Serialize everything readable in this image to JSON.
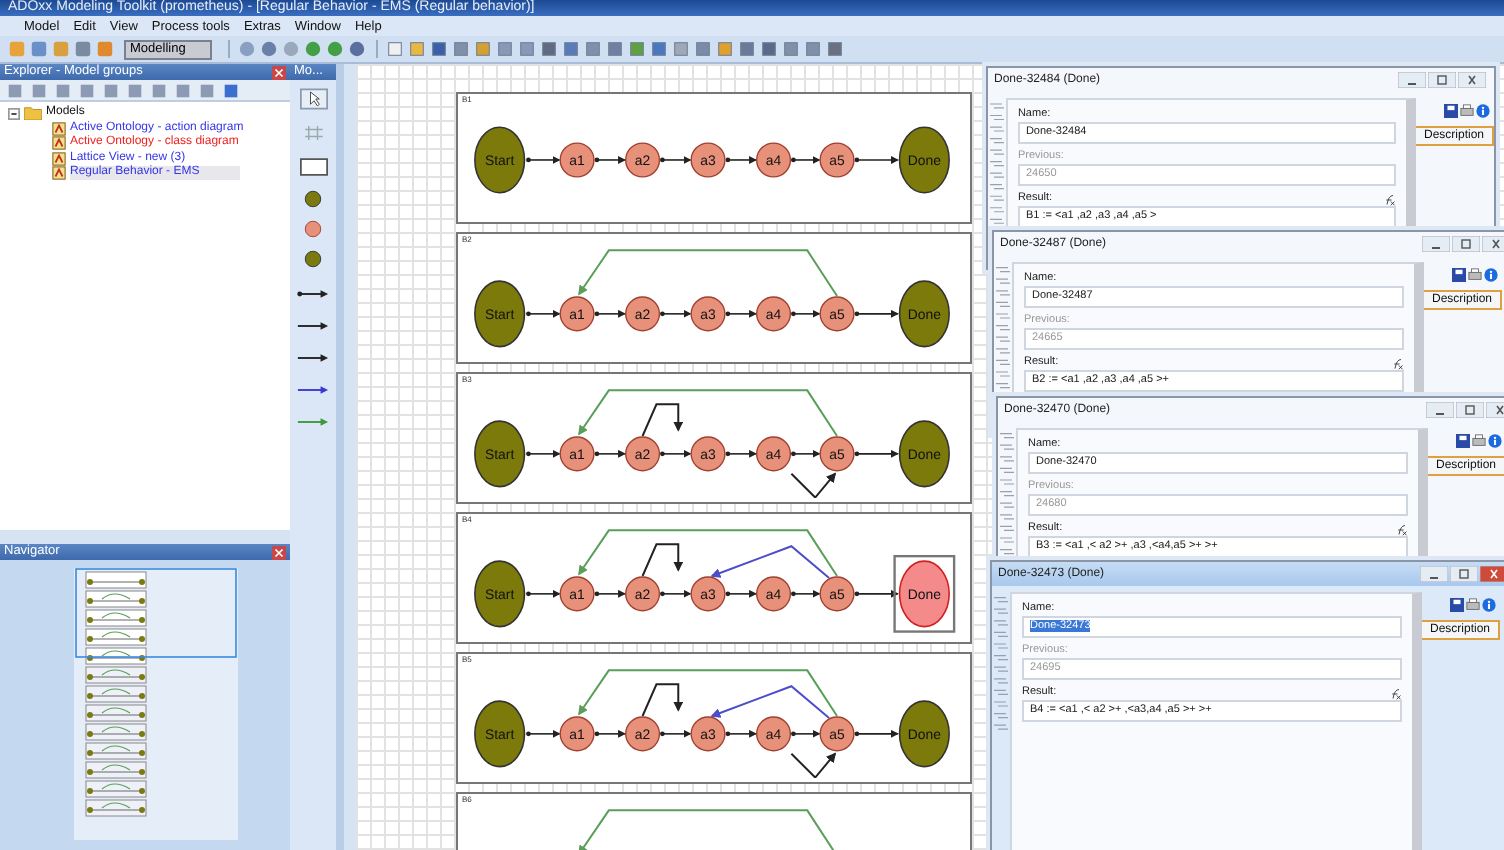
{
  "window": {
    "title": "ADOxx Modeling Toolkit (prometheus) - [Regular Behavior - EMS (Regular behavior)]"
  },
  "menu": [
    "Model",
    "Edit",
    "View",
    "Process tools",
    "Extras",
    "Window",
    "Help"
  ],
  "toolbar": {
    "mode": "Modelling"
  },
  "explorer": {
    "title": "Explorer - Model groups",
    "tree": [
      {
        "label": "Models",
        "expanded": true,
        "children": [
          {
            "label": "Active Ontology - action diagram",
            "color": "#3535e8",
            "selected": false
          },
          {
            "label": "Active Ontology - class diagram",
            "color": "#f02020",
            "selected": false
          },
          {
            "label": "Lattice View - new (3)",
            "color": "#3535e8",
            "selected": false
          },
          {
            "label": "Regular Behavior - EMS",
            "color": "#3535e8",
            "selected": true
          }
        ]
      }
    ]
  },
  "palette": {
    "title": "Mo..."
  },
  "navigator": {
    "title": "Navigator"
  },
  "diagrams": [
    {
      "label": "B1",
      "nodes": [
        {
          "label": "Start",
          "kind": "terminal",
          "selected": false
        },
        {
          "label": "a1",
          "kind": "activity",
          "selected": false
        },
        {
          "label": "a2",
          "kind": "activity",
          "selected": false
        },
        {
          "label": "a3",
          "kind": "activity",
          "selected": false
        },
        {
          "label": "a4",
          "kind": "activity",
          "selected": false
        },
        {
          "label": "a5",
          "kind": "activity",
          "selected": false
        },
        {
          "label": "Done",
          "kind": "terminal",
          "selected": false
        }
      ]
    },
    {
      "label": "B2",
      "nodes": [
        {
          "label": "Start",
          "kind": "terminal",
          "selected": false
        },
        {
          "label": "a1",
          "kind": "activity",
          "selected": false
        },
        {
          "label": "a2",
          "kind": "activity",
          "selected": false
        },
        {
          "label": "a3",
          "kind": "activity",
          "selected": false
        },
        {
          "label": "a4",
          "kind": "activity",
          "selected": false
        },
        {
          "label": "a5",
          "kind": "activity",
          "selected": false
        },
        {
          "label": "Done",
          "kind": "terminal",
          "selected": false
        }
      ],
      "arcs": [
        {
          "kind": "long-back"
        }
      ]
    },
    {
      "label": "B3",
      "nodes": [
        {
          "label": "Start",
          "kind": "terminal",
          "selected": false
        },
        {
          "label": "a1",
          "kind": "activity",
          "selected": false
        },
        {
          "label": "a2",
          "kind": "activity",
          "selected": false
        },
        {
          "label": "a3",
          "kind": "activity",
          "selected": false
        },
        {
          "label": "a4",
          "kind": "activity",
          "selected": false
        },
        {
          "label": "a5",
          "kind": "activity",
          "selected": false
        },
        {
          "label": "Done",
          "kind": "terminal",
          "selected": false
        }
      ],
      "arcs": [
        {
          "kind": "long-back"
        },
        {
          "kind": "self-loop"
        },
        {
          "kind": "under-v"
        }
      ]
    },
    {
      "label": "B4",
      "nodes": [
        {
          "label": "Start",
          "kind": "terminal",
          "selected": false
        },
        {
          "label": "a1",
          "kind": "activity",
          "selected": false
        },
        {
          "label": "a2",
          "kind": "activity",
          "selected": false
        },
        {
          "label": "a3",
          "kind": "activity",
          "selected": false
        },
        {
          "label": "a4",
          "kind": "activity",
          "selected": false
        },
        {
          "label": "a5",
          "kind": "activity",
          "selected": false
        },
        {
          "label": "Done",
          "kind": "terminal",
          "selected": true
        }
      ],
      "arcs": [
        {
          "kind": "long-back"
        },
        {
          "kind": "self-loop"
        },
        {
          "kind": "short-back"
        }
      ]
    },
    {
      "label": "B5",
      "nodes": [
        {
          "label": "Start",
          "kind": "terminal",
          "selected": false
        },
        {
          "label": "a1",
          "kind": "activity",
          "selected": false
        },
        {
          "label": "a2",
          "kind": "activity",
          "selected": false
        },
        {
          "label": "a3",
          "kind": "activity",
          "selected": false
        },
        {
          "label": "a4",
          "kind": "activity",
          "selected": false
        },
        {
          "label": "a5",
          "kind": "activity",
          "selected": false
        },
        {
          "label": "Done",
          "kind": "terminal",
          "selected": false
        }
      ],
      "arcs": [
        {
          "kind": "long-back"
        },
        {
          "kind": "self-loop"
        },
        {
          "kind": "short-back"
        },
        {
          "kind": "under-v"
        }
      ]
    },
    {
      "label": "B6",
      "arcs": [
        {
          "kind": "long-back"
        }
      ]
    }
  ],
  "dialogs": [
    {
      "title": "Done-32484 (Done)",
      "active": false,
      "tab": "Description",
      "fields": [
        {
          "label": "Name:",
          "value": "Done-32484",
          "disabled": false,
          "selected": false
        },
        {
          "label": "Previous:",
          "value": "24650",
          "disabled": true,
          "selected": false
        },
        {
          "label": "Result:",
          "value": "B1 := <a1 ,a2 ,a3 ,a4 ,a5 >",
          "disabled": false,
          "selected": false
        }
      ]
    },
    {
      "title": "Done-32487 (Done)",
      "active": false,
      "tab": "Description",
      "fields": [
        {
          "label": "Name:",
          "value": "Done-32487",
          "disabled": false,
          "selected": false
        },
        {
          "label": "Previous:",
          "value": "24665",
          "disabled": true,
          "selected": false
        },
        {
          "label": "Result:",
          "value": "B2 := <a1 ,a2 ,a3 ,a4 ,a5 >+",
          "disabled": false,
          "selected": false
        }
      ]
    },
    {
      "title": "Done-32470 (Done)",
      "active": false,
      "tab": "Description",
      "fields": [
        {
          "label": "Name:",
          "value": "Done-32470",
          "disabled": false,
          "selected": false
        },
        {
          "label": "Previous:",
          "value": "24680",
          "disabled": true,
          "selected": false
        },
        {
          "label": "Result:",
          "value": "B3 := <a1 ,< a2 >+ ,a3 ,<a4,a5 >+ >+",
          "disabled": false,
          "selected": false
        }
      ]
    },
    {
      "title": "Done-32473 (Done)",
      "active": true,
      "tab": "Description",
      "fields": [
        {
          "label": "Name:",
          "value": "Done-32473",
          "disabled": false,
          "selected": true
        },
        {
          "label": "Previous:",
          "value": "24695",
          "disabled": true,
          "selected": false
        },
        {
          "label": "Result:",
          "value": "B4 := <a1 ,< a2 >+ ,<a3,a4 ,a5 >+ >+",
          "disabled": false,
          "selected": false
        }
      ]
    }
  ]
}
